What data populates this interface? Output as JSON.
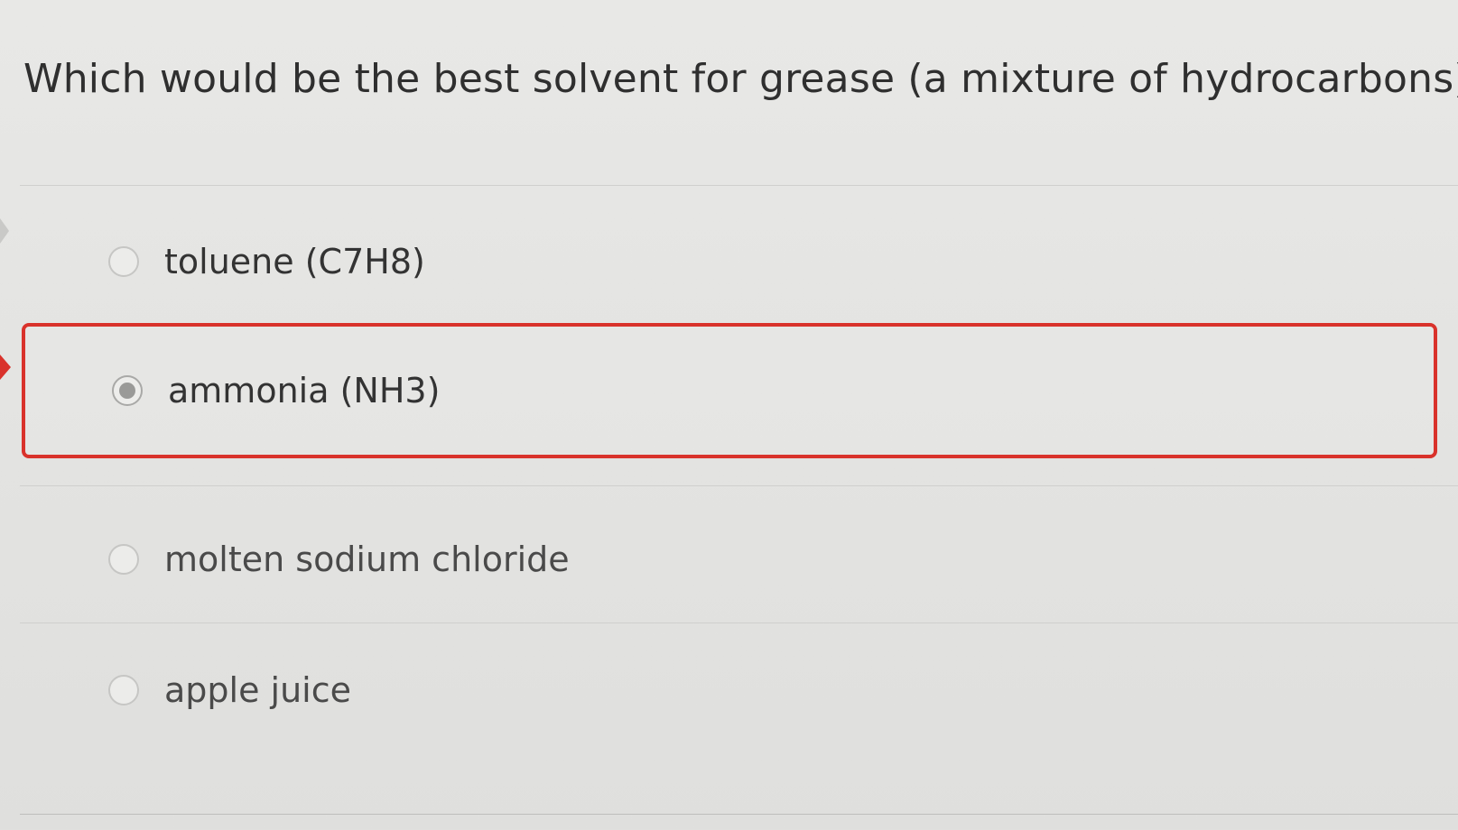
{
  "question": {
    "text": "Which would be the best solvent for grease (a mixture of hydrocarbons)"
  },
  "options": [
    {
      "label": "toluene (C7H8)",
      "selected": false
    },
    {
      "label": "ammonia (NH3)",
      "selected": true
    },
    {
      "label": "molten sodium chloride",
      "selected": false
    },
    {
      "label": "apple juice",
      "selected": false
    }
  ],
  "colors": {
    "selection_border": "#d9322b",
    "background": "#e6e6e4",
    "text": "#333333"
  },
  "icons": {
    "radio": "radio-button-icon",
    "marker": "chevron-right-icon"
  }
}
